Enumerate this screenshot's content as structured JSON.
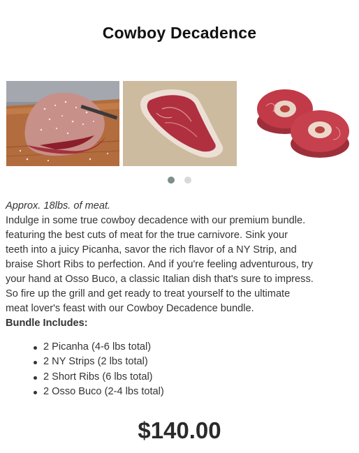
{
  "product": {
    "title": "Cowboy Decadence",
    "price": "$140.00"
  },
  "gallery": {
    "images": [
      {
        "name": "picanha-roast-image"
      },
      {
        "name": "ny-strip-steak-image"
      },
      {
        "name": "osso-buco-image"
      }
    ],
    "page_count": 2,
    "active_page": 1
  },
  "description": {
    "approx": "Approx. 18lbs. of meat.",
    "lines": [
      "Indulge in some true cowboy decadence with our premium bundle.",
      "featuring the best cuts of meat for the true carnivore. Sink your",
      "teeth into a juicy Picanha, savor the rich flavor of a NY Strip, and",
      "braise Short Ribs to perfection. And if you're feeling adventurous, try",
      "your hand at Osso Buco, a classic Italian dish that's sure to impress.",
      "So fire up the grill and get ready to treat yourself to the ultimate",
      "meat lover's feast with our Cowboy Decadence bundle."
    ],
    "includes_heading": "Bundle Includes:"
  },
  "bundle_items": [
    "2 Picanha (4-6 lbs total)",
    "2 NY Strips (2 lbs total)",
    "2 Short Ribs (6 lbs total)",
    "2 Osso Buco (2-4 lbs total)"
  ],
  "colors": {
    "dot_active": "#7d8f86",
    "dot_inactive": "#d9d9d9"
  }
}
